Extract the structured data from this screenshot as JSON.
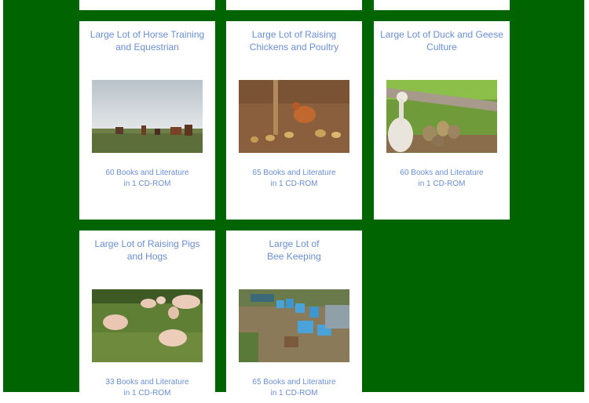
{
  "cards": [
    {
      "title": "Large Lot of Horse Training and Equestrian",
      "desc_line1": "60 Books and Literature",
      "desc_line2": "in 1 CD-ROM",
      "image": "horses-in-field-photo"
    },
    {
      "title": "Large Lot of Raising Chickens and Poultry",
      "desc_line1": "65 Books and Literature",
      "desc_line2": "in 1 CD-ROM",
      "image": "chickens-photo"
    },
    {
      "title": "Large Lot of Duck and Geese Culture",
      "desc_line1": "60 Books and Literature",
      "desc_line2": "in 1 CD-ROM",
      "image": "goose-and-ducklings-photo"
    },
    {
      "title": "Large Lot of Raising Pigs and Hogs",
      "desc_line1": "33 Books and Literature",
      "desc_line2": "in 1 CD-ROM",
      "image": "pigs-in-pasture-photo"
    },
    {
      "title_line1": "Large Lot of",
      "title_line2": "Bee Keeping",
      "desc_line1": "65 Books and Literature",
      "desc_line2": "in 1 CD-ROM",
      "image": "beehives-photo"
    }
  ],
  "colors": {
    "background": "#006400",
    "card": "#ffffff",
    "link_text": "#6a8fd4"
  }
}
